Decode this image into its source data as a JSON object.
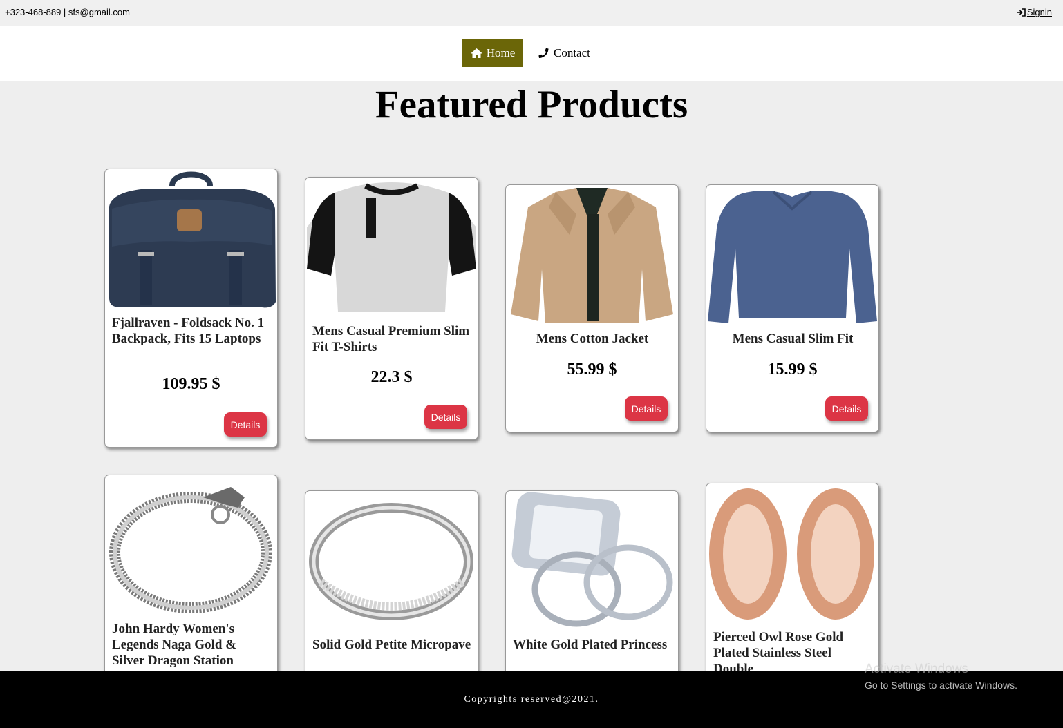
{
  "topbar": {
    "contact": "+323-468-889 | sfs@gmail.com",
    "signin": "Signin"
  },
  "nav": {
    "home": "Home",
    "contact": "Contact",
    "accent": "#6b6608"
  },
  "page_title": "Featured Products",
  "products": [
    {
      "name": "Fjallraven - Foldsack No. 1 Backpack, Fits 15 Laptops",
      "price": "109.95 $",
      "button": "Details",
      "image": "backpack"
    },
    {
      "name": "Mens Casual Premium Slim Fit T-Shirts",
      "price": "22.3 $",
      "button": "Details",
      "image": "raglan-tshirt"
    },
    {
      "name": "Mens Cotton Jacket",
      "price": "55.99 $",
      "button": "Details",
      "image": "jacket"
    },
    {
      "name": "Mens Casual Slim Fit",
      "price": "15.99 $",
      "button": "Details",
      "image": "long-sleeve-shirt"
    },
    {
      "name": "John Hardy Women's Legends Naga Gold & Silver Dragon Station",
      "image": "dragon-bracelet"
    },
    {
      "name": "Solid Gold Petite Micropave",
      "image": "ring"
    },
    {
      "name": "White Gold Plated Princess",
      "image": "diamond-ring-set"
    },
    {
      "name": "Pierced Owl Rose Gold Plated Stainless Steel Double",
      "image": "rose-gold-tunnels"
    }
  ],
  "footer": "Copyrights reserved@2021.",
  "watermark": {
    "line1": "Activate Windows",
    "line2": "Go to Settings to activate Windows."
  },
  "colors": {
    "button": "#dc3545",
    "footer": "#000000",
    "background": "#eeeeee"
  }
}
